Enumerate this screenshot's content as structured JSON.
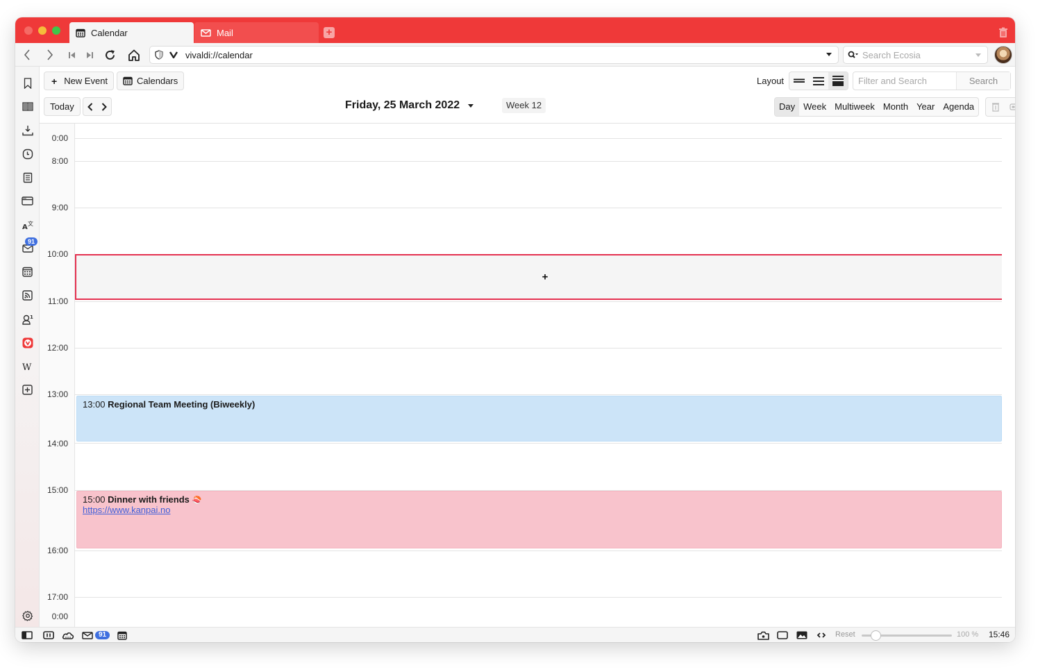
{
  "browser": {
    "tabs": [
      {
        "label": "Calendar",
        "icon": "calendar-icon",
        "active": true
      },
      {
        "label": "Mail",
        "icon": "mail-icon",
        "active": false
      }
    ],
    "url": "vivaldi://calendar",
    "search_placeholder": "Search Ecosia",
    "accent_color": "#ef3939"
  },
  "side_panel": {
    "items": [
      {
        "name": "bookmarks",
        "icon": "bookmark-icon"
      },
      {
        "name": "reading-list",
        "icon": "book-icon"
      },
      {
        "name": "downloads",
        "icon": "download-icon"
      },
      {
        "name": "history",
        "icon": "clock-icon"
      },
      {
        "name": "notes",
        "icon": "notes-icon"
      },
      {
        "name": "window",
        "icon": "window-icon"
      },
      {
        "name": "translate",
        "icon": "translate-icon"
      },
      {
        "name": "mail",
        "icon": "mail-icon",
        "badge": "91"
      },
      {
        "name": "calendar",
        "icon": "calendar-icon"
      },
      {
        "name": "feeds",
        "icon": "rss-icon"
      },
      {
        "name": "contacts",
        "icon": "contacts-icon"
      },
      {
        "name": "vivaldi",
        "icon": "vivaldi-icon"
      },
      {
        "name": "wikipedia",
        "icon": "wikipedia-icon"
      },
      {
        "name": "add-panel",
        "icon": "add-panel-icon"
      }
    ],
    "settings_icon": "gear-icon"
  },
  "calendar": {
    "new_event_label": "New Event",
    "calendars_label": "Calendars",
    "today_label": "Today",
    "date_title": "Friday, 25 March 2022",
    "week_label": "Week 12",
    "layout_label": "Layout",
    "filter_placeholder": "Filter and Search",
    "search_label": "Search",
    "views": [
      {
        "label": "Day",
        "active": true
      },
      {
        "label": "Week",
        "active": false
      },
      {
        "label": "Multiweek",
        "active": false
      },
      {
        "label": "Month",
        "active": false
      },
      {
        "label": "Year",
        "active": false
      },
      {
        "label": "Agenda",
        "active": false
      }
    ],
    "time_labels": [
      "0:00",
      "8:00",
      "9:00",
      "10:00",
      "11:00",
      "12:00",
      "13:00",
      "14:00",
      "15:00",
      "16:00",
      "17:00",
      "0:00"
    ],
    "selection_plus": "+",
    "events": [
      {
        "time": "13:00",
        "title": "Regional Team Meeting (Biweekly)",
        "color": "#cce4f8"
      },
      {
        "time": "15:00",
        "title": "Dinner with friends",
        "emoji": "🍣",
        "link": "https://www.kanpai.no",
        "color": "#f8c3cc"
      }
    ]
  },
  "status_bar": {
    "mail_badge": "91",
    "reset_label": "Reset",
    "zoom_level": "100 %",
    "zoom_fraction": 0.15,
    "clock": "15:46"
  }
}
